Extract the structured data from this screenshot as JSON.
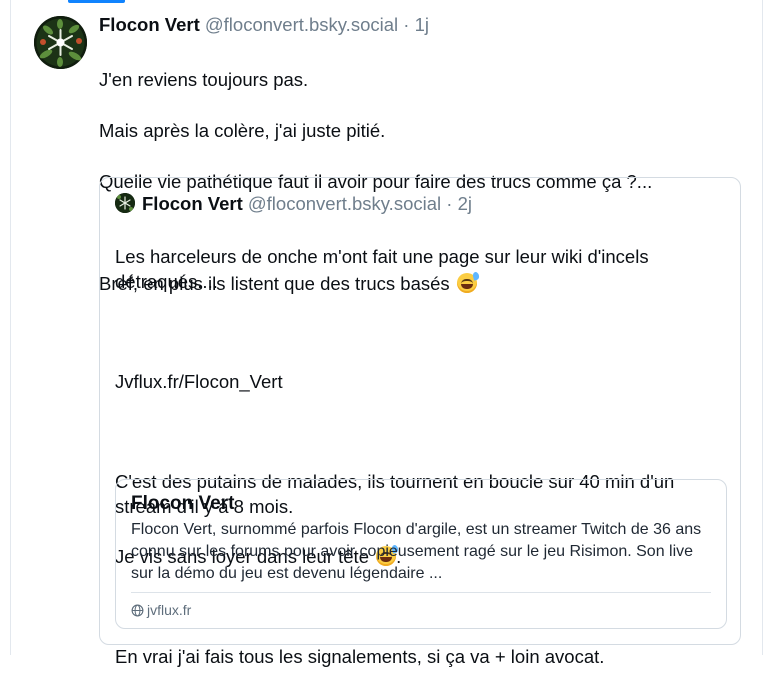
{
  "post": {
    "author_name": "Flocon Vert",
    "handle": "@floconvert.bsky.social",
    "separator": "·",
    "time": "1j",
    "lines": [
      "J'en reviens toujours pas.",
      "Mais après la colère, j'ai juste pitié.",
      "Quelle vie pathétique faut il avoir pour faire des trucs comme ça ?...",
      "",
      "Bref, en plus ils listent que des trucs basés"
    ],
    "emoji": "sweat-smile-emoji"
  },
  "quote": {
    "author_name": "Flocon Vert",
    "handle": "@floconvert.bsky.social",
    "separator": "·",
    "time": "2j",
    "para1": "Les harceleurs de onche m'ont fait une page sur leur wiki d'incels détraqués....",
    "para2": "Jvflux.fr/Flocon_Vert",
    "para3_line1": "C'est des putains de malades, ils tournent en boucle sur 40 min d'un stream d'il y à 8 mois.",
    "para3_line2": "Je vis sans loyer dans leur tête",
    "para4": "En vrai j'ai fais tous les signalements, si ça va + loin avocat.",
    "link_card": {
      "title": "Flocon Vert",
      "description": "Flocon Vert, surnommé parfois Flocon d'argile, est un streamer Twitch de 36 ans connu sur les forums pour avoir copieusement ragé sur le jeu Risimon. Son live sur la démo du jeu est devenu légendaire ...",
      "domain": "jvflux.fr"
    }
  },
  "colors": {
    "accent": "#1083fe",
    "muted_text": "#6f7e8c",
    "border": "#d4dbe2"
  }
}
